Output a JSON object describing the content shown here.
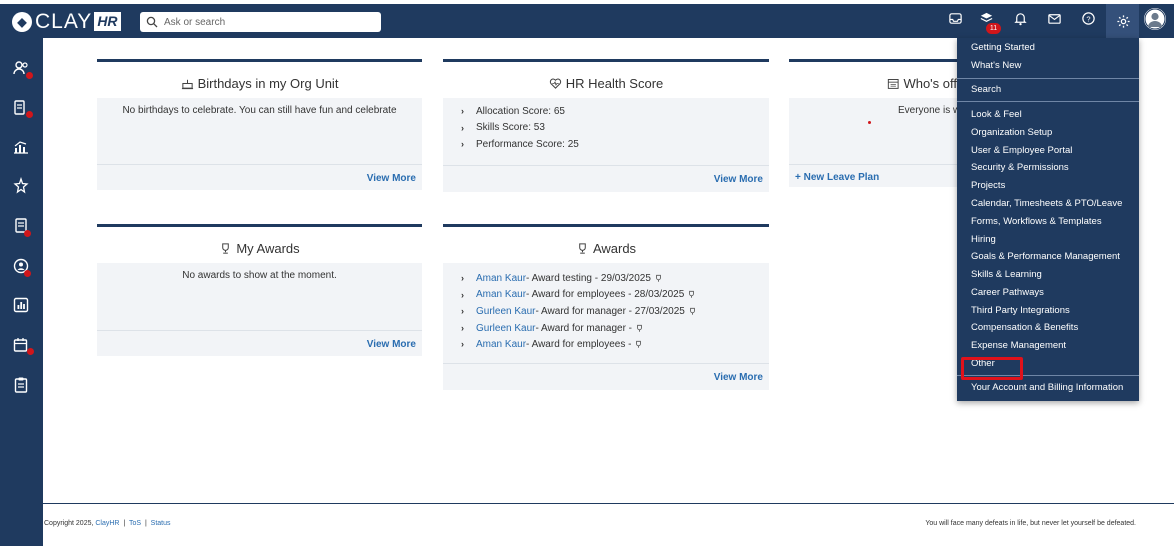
{
  "app": {
    "logo_text": "CLAY",
    "logo_suffix": "HR"
  },
  "search": {
    "placeholder": "Ask or search"
  },
  "topbar": {
    "notification_count": "11"
  },
  "cards": {
    "birthdays": {
      "title": "Birthdays in my Org Unit",
      "message": "No birthdays to celebrate. You can still have fun and celebrate",
      "view_more": "View More"
    },
    "health": {
      "title": "HR Health Score",
      "items": [
        "Allocation Score: 65",
        "Skills Score: 53",
        "Performance Score: 25"
      ],
      "view_more": "View More"
    },
    "whos_off": {
      "title": "Who's off",
      "message": "Everyone is w",
      "new_leave": "+ New Leave Plan"
    },
    "my_awards": {
      "title": "My Awards",
      "message": "No awards to show at the moment.",
      "view_more": "View More"
    },
    "awards": {
      "title": "Awards",
      "items": [
        {
          "name": "Aman Kaur",
          "text": "- Award testing - 29/03/2025"
        },
        {
          "name": "Aman Kaur",
          "text": "- Award for employees - 28/03/2025"
        },
        {
          "name": "Gurleen Kaur",
          "text": "- Award for manager - 27/03/2025"
        },
        {
          "name": "Gurleen Kaur",
          "text": "- Award for manager -"
        },
        {
          "name": "Aman Kaur",
          "text": "- Award for employees -"
        }
      ],
      "view_more": "View More"
    }
  },
  "settings_menu": {
    "group1": [
      "Getting Started",
      "What's New"
    ],
    "group2": [
      "Search"
    ],
    "group3": [
      "Look & Feel",
      "Organization Setup",
      "User & Employee Portal",
      "Security & Permissions",
      "Projects",
      "Calendar, Timesheets & PTO/Leave",
      "Forms, Workflows & Templates",
      "Hiring",
      "Goals & Performance Management",
      "Skills & Learning",
      "Career Pathways",
      "Third Party Integrations",
      "Compensation & Benefits",
      "Expense Management",
      "Other"
    ],
    "group4": [
      "Your Account and Billing Information"
    ]
  },
  "footer": {
    "copyright": "Copyright 2025,",
    "company": "ClayHR",
    "sep": "|",
    "tos": "ToS",
    "status": "Status",
    "quote": "You will face many defeats in life, but never let yourself be defeated."
  },
  "colors": {
    "navbar": "#1f3a5f",
    "accent_link": "#2a6db0",
    "alert_red": "#d0161b"
  }
}
